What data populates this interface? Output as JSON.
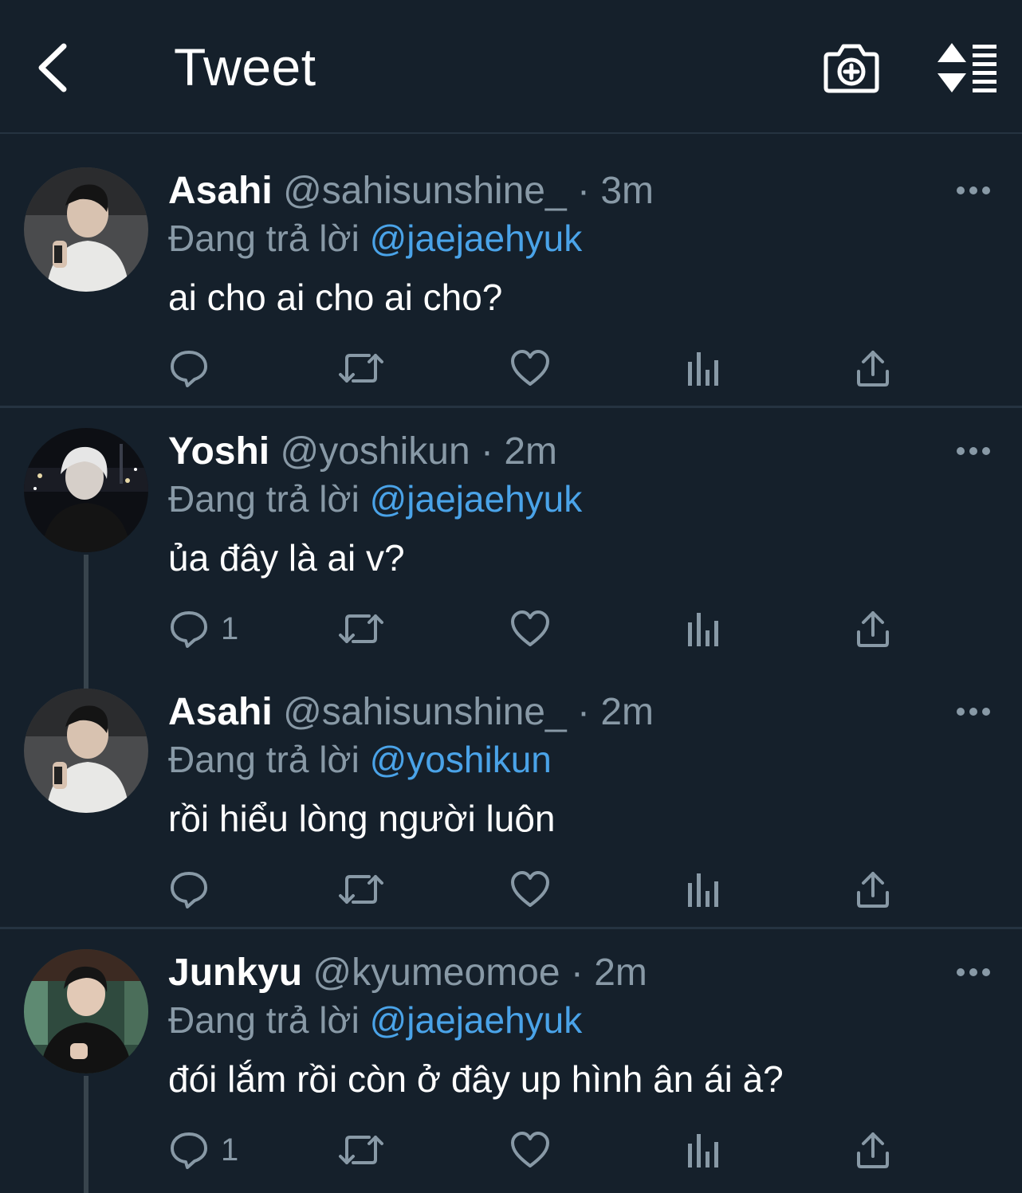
{
  "header": {
    "title": "Tweet",
    "back_icon": "chevron-left-icon",
    "camera_icon": "camera-plus-icon",
    "sort_icon": "sort-list-icon"
  },
  "colors": {
    "background": "#15202b",
    "muted": "#8899a6",
    "mention": "#4aa3e8",
    "divider": "#253341"
  },
  "tweets": [
    {
      "name": "Asahi",
      "handle": "@sahisunshine_",
      "dot": "·",
      "time": "3m",
      "reply_prefix": "Đang trả lời",
      "reply_to": "@jaejaehyuk",
      "text": "ai cho ai cho ai cho?",
      "reply_count": ""
    },
    {
      "name": "Yoshi",
      "handle": "@yoshikun",
      "dot": "·",
      "time": "2m",
      "reply_prefix": "Đang trả lời",
      "reply_to": "@jaejaehyuk",
      "text": "ủa đây là ai v?",
      "reply_count": "1"
    },
    {
      "name": "Asahi",
      "handle": "@sahisunshine_",
      "dot": "·",
      "time": "2m",
      "reply_prefix": "Đang trả lời",
      "reply_to": "@yoshikun",
      "text": "rồi hiểu lòng người luôn",
      "reply_count": ""
    },
    {
      "name": "Junkyu",
      "handle": "@kyumeomoe",
      "dot": "·",
      "time": "2m",
      "reply_prefix": "Đang trả lời",
      "reply_to": "@jaejaehyuk",
      "text": "đói lắm rồi còn ở đây up hình ân ái à?",
      "reply_count": "1"
    }
  ]
}
